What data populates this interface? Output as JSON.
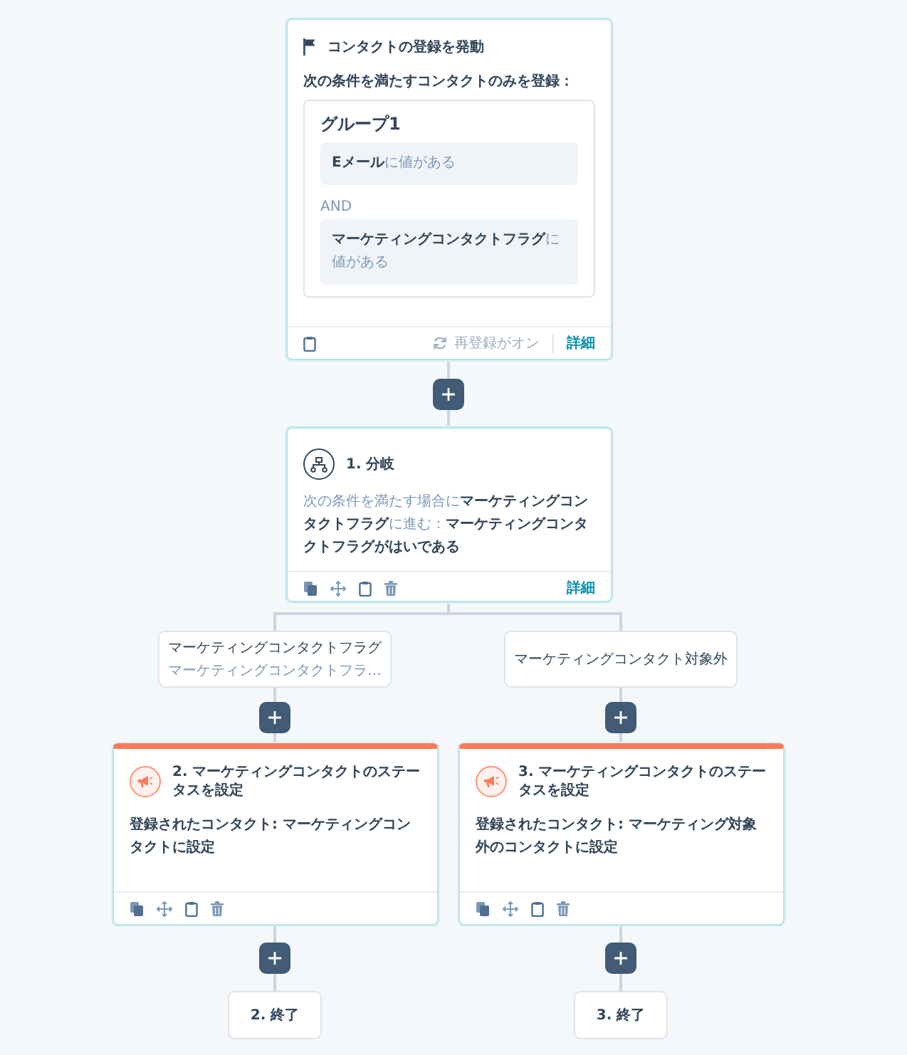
{
  "trigger": {
    "title": "コンタクトの登録を発動",
    "subtitle": "次の条件を満たすコンタクトのみを登録：",
    "group": {
      "title": "グループ1",
      "operator": "AND",
      "conditions": [
        {
          "text": "**Eメール**に値がある"
        },
        {
          "text": "**マーケティングコンタクトフラグ**に値がある"
        }
      ]
    },
    "reenroll": "再登録がオン",
    "details": "詳細"
  },
  "branch": {
    "title": "1. 分岐",
    "description": "次の条件を満たす場合に**マーケティングコンタクトフラグ**に進む：**マーケティングコンタクトフラグがはいである**",
    "details": "詳細"
  },
  "branches": [
    {
      "label": "マーケティングコンタクトフラグ",
      "sublabel": "マーケティングコンタクトフラ…",
      "action": {
        "title": "2. マーケティングコンタクトのステータスを設定",
        "description": "登録されたコンタクト: マーケティングコンタクトに設定"
      },
      "end": "2. 終了"
    },
    {
      "label": "マーケティングコンタクト対象外",
      "action": {
        "title": "3. マーケティングコンタクトのステータスを設定",
        "description": "登録されたコンタクト: マーケティング対象外のコンタクトに設定"
      },
      "end": "3. 終了"
    }
  ]
}
